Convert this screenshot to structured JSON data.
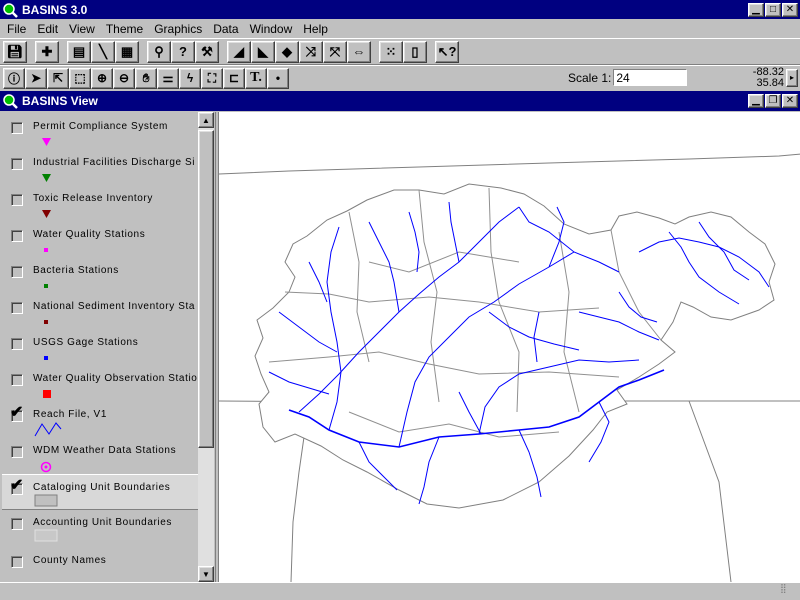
{
  "app": {
    "title": "BASINS 3.0"
  },
  "menu": [
    "File",
    "Edit",
    "View",
    "Theme",
    "Graphics",
    "Data",
    "Window",
    "Help"
  ],
  "toolbar": {
    "scale_label": "Scale 1:",
    "scale_value": "24",
    "coord_x": "-88.32",
    "coord_y": "35.84"
  },
  "view": {
    "title": "BASINS View"
  },
  "themes": [
    {
      "name": "Permit Compliance System",
      "checked": false,
      "symbol": "triangle-magenta",
      "color": "#ff00ff"
    },
    {
      "name": "Industrial Facilities Discharge Si",
      "checked": false,
      "symbol": "triangle-green",
      "color": "#008000"
    },
    {
      "name": "Toxic Release Inventory",
      "checked": false,
      "symbol": "triangle-darkred",
      "color": "#800000"
    },
    {
      "name": "Water Quality Stations",
      "checked": false,
      "symbol": "square-magenta",
      "color": "#ff00ff"
    },
    {
      "name": "Bacteria Stations",
      "checked": false,
      "symbol": "square-green",
      "color": "#008000"
    },
    {
      "name": "National Sediment Inventory Sta",
      "checked": false,
      "symbol": "square-darkred",
      "color": "#800000"
    },
    {
      "name": "USGS Gage Stations",
      "checked": false,
      "symbol": "square-blue",
      "color": "#0000ff"
    },
    {
      "name": "Water Quality Observation Statio",
      "checked": false,
      "symbol": "square-red",
      "color": "#ff0000"
    },
    {
      "name": "Reach File, V1",
      "checked": true,
      "symbol": "line-blue",
      "color": "#0000ff"
    },
    {
      "name": "WDM Weather Data Stations",
      "checked": false,
      "symbol": "circle-magenta",
      "color": "#ff00ff"
    },
    {
      "name": "Cataloging Unit Boundaries",
      "checked": true,
      "symbol": "polygon-gray",
      "color": "#808080"
    },
    {
      "name": "Accounting Unit Boundaries",
      "checked": false,
      "symbol": "polygon-lightgray",
      "color": "#c0c0c0"
    },
    {
      "name": "County Names",
      "checked": false,
      "symbol": "none",
      "color": ""
    }
  ],
  "colors": {
    "titlebar": "#000080",
    "river": "#0000ff",
    "boundary": "#808080"
  }
}
